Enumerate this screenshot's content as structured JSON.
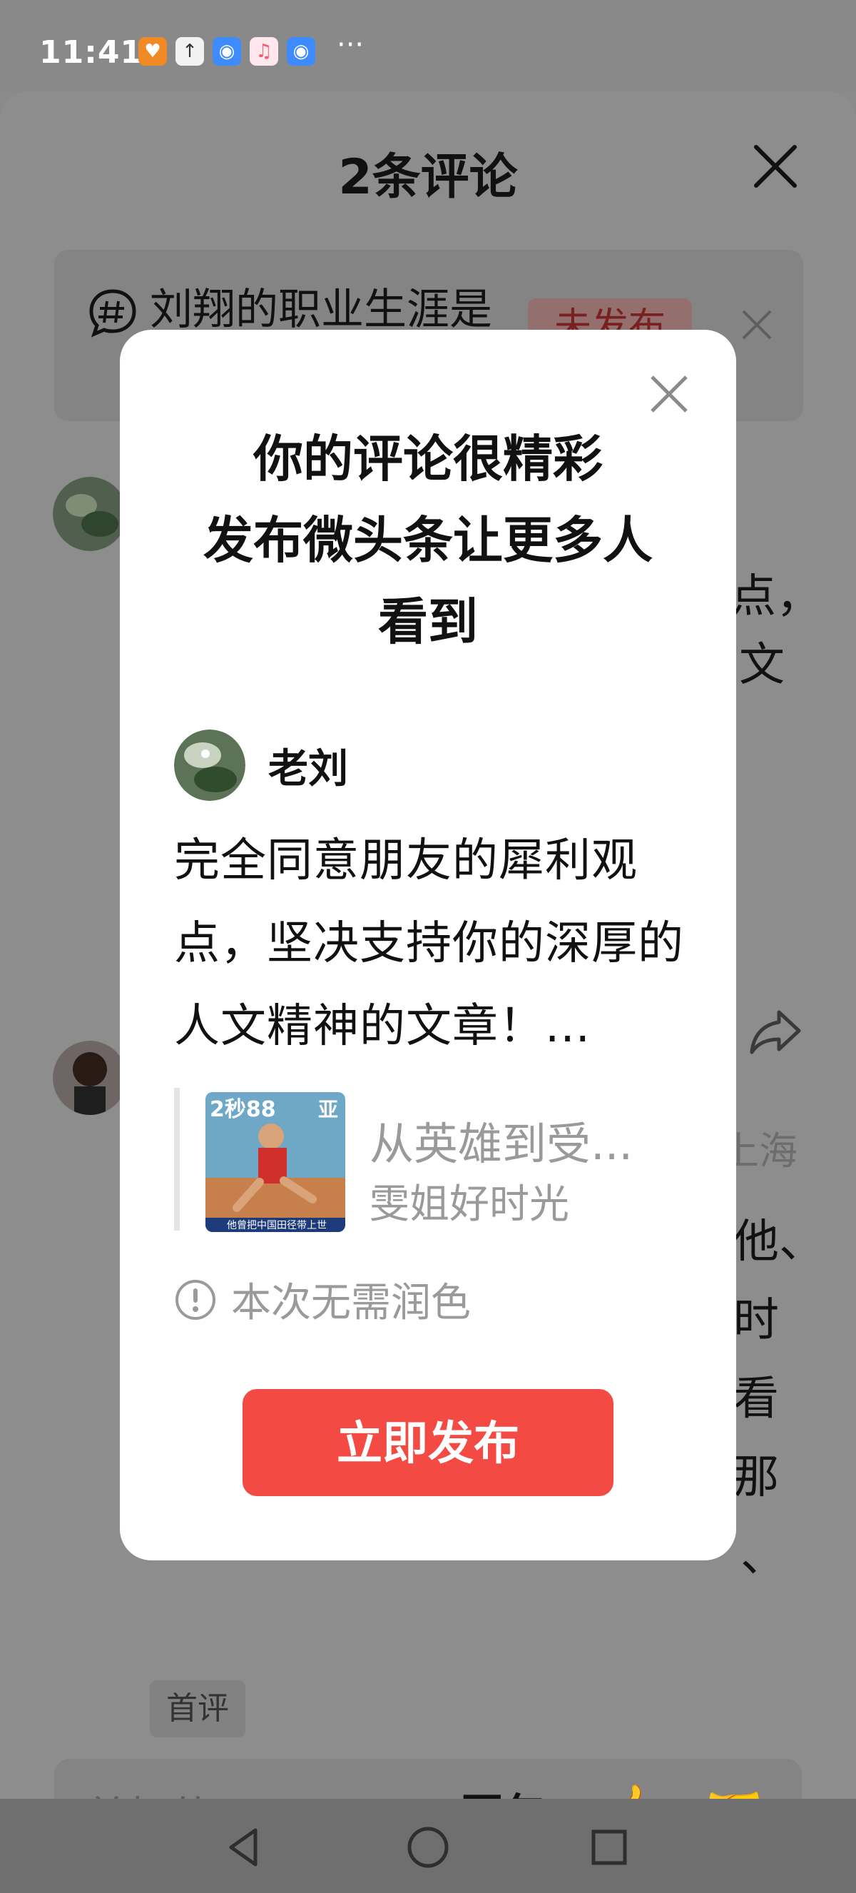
{
  "status_bar": {
    "time": "11:41",
    "more": "···",
    "icons": [
      "app-orange-icon",
      "upload-icon",
      "browser-icon",
      "music-icon",
      "browser-icon"
    ],
    "colors": {
      "app": "#f08a24",
      "upload": "#ffffff",
      "browser": "#3d8bff",
      "music": "#f55a6e"
    }
  },
  "sheet": {
    "title": "2条评论",
    "topic_text": "刘翔的职业生涯是",
    "topic_badge": "未发布",
    "first_tag": "首评",
    "background_fragments": {
      "line1": "点，",
      "line2": "文",
      "location": "上海",
      "c1": "他、",
      "c2": "时",
      "c3": "看",
      "c4": "那",
      "c5": "、"
    }
  },
  "reply_bar": {
    "placeholder": "美好的一天...",
    "mention": "@豆包",
    "emoji1": "👍",
    "emoji2": "🤝"
  },
  "dialog": {
    "title_lines": [
      "你的评论很精彩",
      "发布微头条让更多人",
      "看到"
    ],
    "author": "老刘",
    "body": "完全同意朋友的犀利观点，坚决支持你的深厚的人文精神的文章！...",
    "quote_title": "从英雄到受...",
    "quote_author": "雯姐好时光",
    "thumb_text": "2秒88",
    "thumb_text2": "亚",
    "thumb_caption": "他曾把中国田径带上世",
    "hint": "本次无需润色",
    "publish_label": "立即发布",
    "accent_color": "#f34a44"
  }
}
